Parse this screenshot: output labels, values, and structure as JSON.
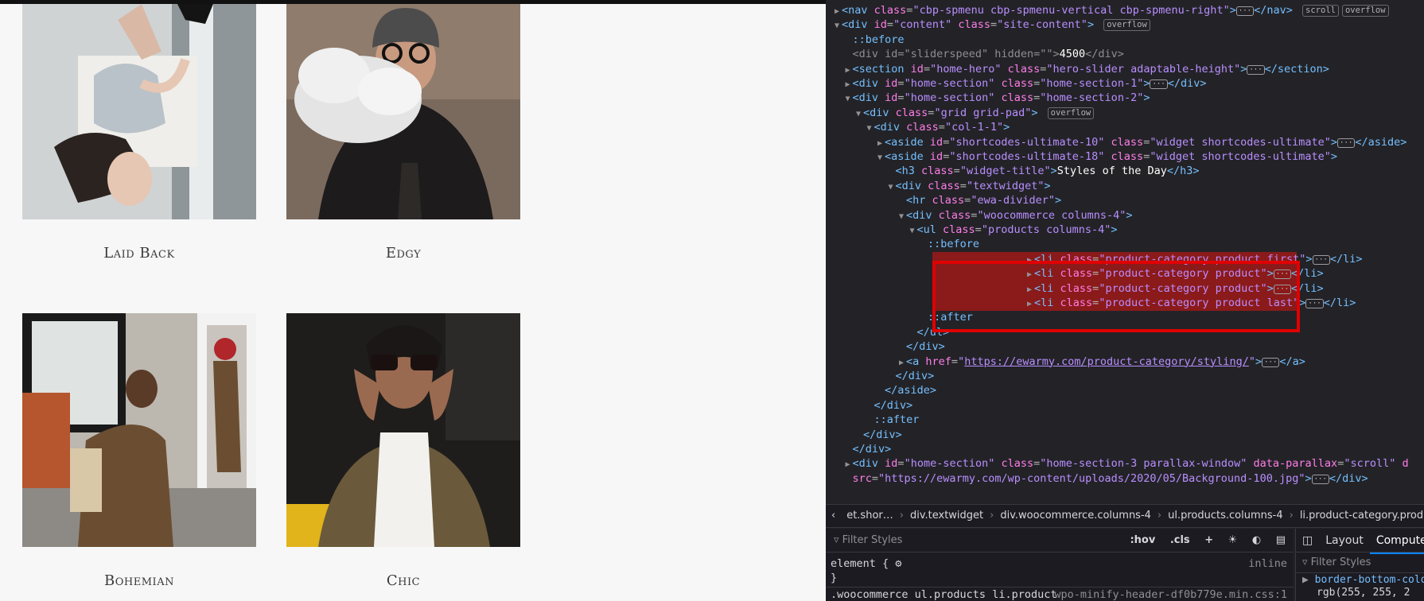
{
  "page": {
    "products": [
      {
        "name": "Laid Back"
      },
      {
        "name": "Edgy"
      },
      {
        "name": "Bohemian"
      },
      {
        "name": "Chic"
      }
    ]
  },
  "devtools": {
    "lines": [
      {
        "indent": 0,
        "twisty": "▶",
        "html": "<span class='tag'>&lt;nav</span> <span class='attr'>class</span>=<span class='val'>\"cbp-spmenu cbp-spmenu-vertical cbp-spmenu-right\"</span><span class='tag'>&gt;</span><span class='ell'>···</span><span class='tag'>&lt;/nav&gt;</span> <span class='badge'>scroll</span><span class='badge'>overflow</span>"
      },
      {
        "indent": 0,
        "twisty": "▼",
        "html": "<span class='tag'>&lt;div</span> <span class='attr'>id</span>=<span class='val'>\"content\"</span> <span class='attr'>class</span>=<span class='val'>\"site-content\"</span><span class='tag'>&gt;</span> <span class='badge'>overflow</span>"
      },
      {
        "indent": 1,
        "twisty": "",
        "html": "<span class='pseudo'>::before</span>"
      },
      {
        "indent": 1,
        "twisty": "",
        "html": "<span class='dim'>&lt;div id=\"sliderspeed\" hidden=\"\"&gt;</span><span class='txt'>4500</span><span class='dim'>&lt;/div&gt;</span>"
      },
      {
        "indent": 1,
        "twisty": "▶",
        "html": "<span class='tag'>&lt;section</span> <span class='attr'>id</span>=<span class='val'>\"home-hero\"</span> <span class='attr'>class</span>=<span class='val'>\"hero-slider adaptable-height\"</span><span class='tag'>&gt;</span><span class='ell'>···</span><span class='tag'>&lt;/section&gt;</span>"
      },
      {
        "indent": 1,
        "twisty": "▶",
        "html": "<span class='tag'>&lt;div</span> <span class='attr'>id</span>=<span class='val'>\"home-section\"</span> <span class='attr'>class</span>=<span class='val'>\"home-section-1\"</span><span class='tag'>&gt;</span><span class='ell'>···</span><span class='tag'>&lt;/div&gt;</span>"
      },
      {
        "indent": 1,
        "twisty": "▼",
        "html": "<span class='tag'>&lt;div</span> <span class='attr'>id</span>=<span class='val'>\"home-section\"</span> <span class='attr'>class</span>=<span class='val'>\"home-section-2\"</span><span class='tag'>&gt;</span>"
      },
      {
        "indent": 2,
        "twisty": "▼",
        "html": "<span class='tag'>&lt;div</span> <span class='attr'>class</span>=<span class='val'>\"grid grid-pad\"</span><span class='tag'>&gt;</span> <span class='badge'>overflow</span>"
      },
      {
        "indent": 3,
        "twisty": "▼",
        "html": "<span class='tag'>&lt;div</span> <span class='attr'>class</span>=<span class='val'>\"col-1-1\"</span><span class='tag'>&gt;</span>"
      },
      {
        "indent": 4,
        "twisty": "▶",
        "html": "<span class='tag'>&lt;aside</span> <span class='attr'>id</span>=<span class='val'>\"shortcodes-ultimate-10\"</span> <span class='attr'>class</span>=<span class='val'>\"widget shortcodes-ultimate\"</span><span class='tag'>&gt;</span><span class='ell'>···</span><span class='tag'>&lt;/aside&gt;</span>"
      },
      {
        "indent": 4,
        "twisty": "▼",
        "html": "<span class='tag'>&lt;aside</span> <span class='attr'>id</span>=<span class='val'>\"shortcodes-ultimate-18\"</span> <span class='attr'>class</span>=<span class='val'>\"widget shortcodes-ultimate\"</span><span class='tag'>&gt;</span>"
      },
      {
        "indent": 5,
        "twisty": "",
        "html": "<span class='tag'>&lt;h3</span> <span class='attr'>class</span>=<span class='val'>\"widget-title\"</span><span class='tag'>&gt;</span><span class='txt'>Styles of the Day</span><span class='tag'>&lt;/h3&gt;</span>"
      },
      {
        "indent": 5,
        "twisty": "▼",
        "html": "<span class='tag'>&lt;div</span> <span class='attr'>class</span>=<span class='val'>\"textwidget\"</span><span class='tag'>&gt;</span>"
      },
      {
        "indent": 6,
        "twisty": "",
        "html": "<span class='tag'>&lt;hr</span> <span class='attr'>class</span>=<span class='val'>\"ewa-divider\"</span><span class='tag'>&gt;</span>"
      },
      {
        "indent": 6,
        "twisty": "▼",
        "html": "<span class='tag'>&lt;div</span> <span class='attr'>class</span>=<span class='val'>\"woocommerce columns-4\"</span><span class='tag'>&gt;</span>"
      },
      {
        "indent": 7,
        "twisty": "▼",
        "html": "<span class='tag'>&lt;ul</span> <span class='attr'>class</span>=<span class='val'>\"products columns-4\"</span><span class='tag'>&gt;</span>"
      },
      {
        "indent": 8,
        "twisty": "",
        "html": "<span class='pseudo'>::before</span>"
      },
      {
        "indent": 8,
        "twisty": "▶",
        "sel": true,
        "html": "<span class='tag'>&lt;li</span> <span class='attr'>class</span>=<span class='val'>\"product-category product first\"</span><span class='tag'>&gt;</span><span class='ell'>···</span><span class='tag'>&lt;/li&gt;</span>"
      },
      {
        "indent": 8,
        "twisty": "▶",
        "sel": true,
        "html": "<span class='tag'>&lt;li</span> <span class='attr'>class</span>=<span class='val'>\"product-category product\"</span><span class='tag'>&gt;</span><span class='ell'>···</span><span class='tag'>&lt;/li&gt;</span>"
      },
      {
        "indent": 8,
        "twisty": "▶",
        "sel": true,
        "html": "<span class='tag'>&lt;li</span> <span class='attr'>class</span>=<span class='val'>\"product-category product\"</span><span class='tag'>&gt;</span><span class='ell'>···</span><span class='tag'>&lt;/li&gt;</span>"
      },
      {
        "indent": 8,
        "twisty": "▶",
        "sel": true,
        "html": "<span class='tag'>&lt;li</span> <span class='attr'>class</span>=<span class='val'>\"product-category product last\"</span><span class='tag'>&gt;</span><span class='ell'>···</span><span class='tag'>&lt;/li&gt;</span>"
      },
      {
        "indent": 8,
        "twisty": "",
        "html": "<span class='pseudo'>::after</span>"
      },
      {
        "indent": 7,
        "twisty": "",
        "html": "<span class='tag'>&lt;/ul&gt;</span>"
      },
      {
        "indent": 6,
        "twisty": "",
        "html": "<span class='tag'>&lt;/div&gt;</span>"
      },
      {
        "indent": 6,
        "twisty": "▶",
        "html": "<span class='tag'>&lt;a</span> <span class='attr'>href</span>=<span class='val'>\"</span><span class='link'>https://ewarmy.com/product-category/styling/</span><span class='val'>\"</span><span class='tag'>&gt;</span><span class='ell'>···</span><span class='tag'>&lt;/a&gt;</span>"
      },
      {
        "indent": 5,
        "twisty": "",
        "html": "<span class='tag'>&lt;/div&gt;</span>"
      },
      {
        "indent": 4,
        "twisty": "",
        "html": "<span class='tag'>&lt;/aside&gt;</span>"
      },
      {
        "indent": 3,
        "twisty": "",
        "html": "<span class='tag'>&lt;/div&gt;</span>"
      },
      {
        "indent": 3,
        "twisty": "",
        "html": "<span class='pseudo'>::after</span>"
      },
      {
        "indent": 2,
        "twisty": "",
        "html": "<span class='tag'>&lt;/div&gt;</span>"
      },
      {
        "indent": 1,
        "twisty": "",
        "html": "<span class='tag'>&lt;/div&gt;</span>"
      },
      {
        "indent": 1,
        "twisty": "▶",
        "html": "<span class='tag'>&lt;div</span> <span class='attr'>id</span>=<span class='val'>\"home-section\"</span> <span class='attr'>class</span>=<span class='val'>\"home-section-3 parallax-window\"</span> <span class='attr'>data-parallax</span>=<span class='val'>\"scroll\"</span> <span class='attr'>d</span>"
      },
      {
        "indent": 1,
        "twisty": "",
        "html": "<span class='attr'>src</span>=<span class='val'>\"https://ewarmy.com/wp-content/uploads/2020/05/Background-100.jpg\"</span><span class='tag'>&gt;</span><span class='ell'>···</span><span class='tag'>&lt;/div&gt;</span>"
      }
    ],
    "breadcrumbs": [
      "et.shor…",
      "div.textwidget",
      "div.woocommerce.columns-4",
      "ul.products.columns-4",
      "li.product-category.product.first"
    ],
    "styles": {
      "filter_placeholder": "Filter Styles",
      "hov": ":hov",
      "cls": ".cls",
      "element_rule": "element {",
      "inline": "inline",
      "close_brace": "}",
      "selector": ".woocommerce ul.products li.product",
      "source": "wpo-minify-header-df0b779e.min.css:1"
    },
    "side": {
      "tab_layout": "Layout",
      "tab_computed": "Computed",
      "filter_placeholder": "Filter Styles",
      "prop": "border-bottom-colo",
      "prop_value": "rgb(255, 255, 2"
    }
  }
}
